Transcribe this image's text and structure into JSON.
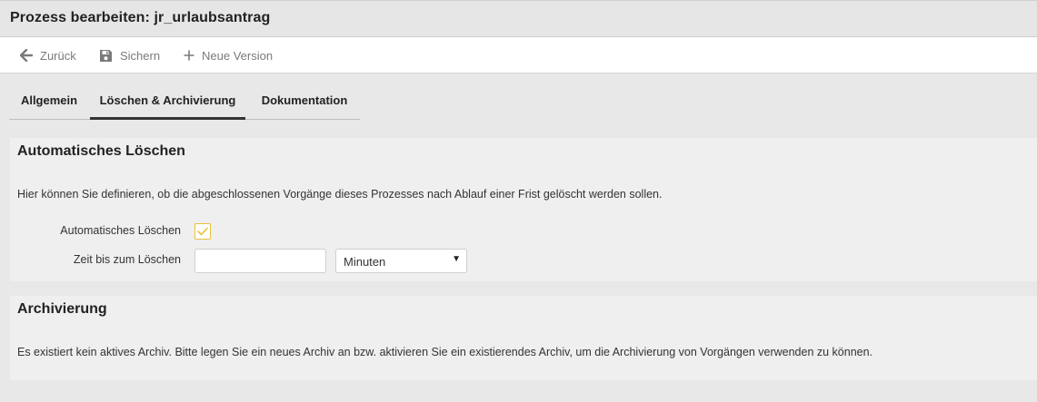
{
  "window": {
    "title": "Prozess bearbeiten: jr_urlaubsantrag"
  },
  "toolbar": {
    "back_label": "Zurück",
    "back_icon": "arrow-left-icon",
    "save_label": "Sichern",
    "save_icon": "floppy-disk-icon",
    "new_version_label": "Neue Version",
    "new_version_icon": "plus-icon"
  },
  "tabs": [
    {
      "label": "Allgemein",
      "active": false
    },
    {
      "label": "Löschen & Archivierung",
      "active": true
    },
    {
      "label": "Dokumentation",
      "active": false
    }
  ],
  "auto_delete": {
    "heading": "Automatisches Löschen",
    "description": "Hier können Sie definieren, ob die abgeschlossenen Vorgänge dieses Prozesses nach Ablauf einer Frist gelöscht werden sollen.",
    "checkbox_label": "Automatisches Löschen",
    "checkbox_checked": true,
    "time_label": "Zeit bis zum Löschen",
    "time_value": "",
    "unit_selected": "Minuten"
  },
  "archive": {
    "heading": "Archivierung",
    "description": "Es existiert kein aktives Archiv. Bitte legen Sie ein neues Archiv an bzw. aktivieren Sie ein existierendes Archiv, um die Archivierung von Vorgängen verwenden zu können."
  },
  "colors": {
    "accent_checkbox": "#e8c23a",
    "active_tab_underline": "#333333",
    "toolbar_text": "#7a7a7a"
  }
}
